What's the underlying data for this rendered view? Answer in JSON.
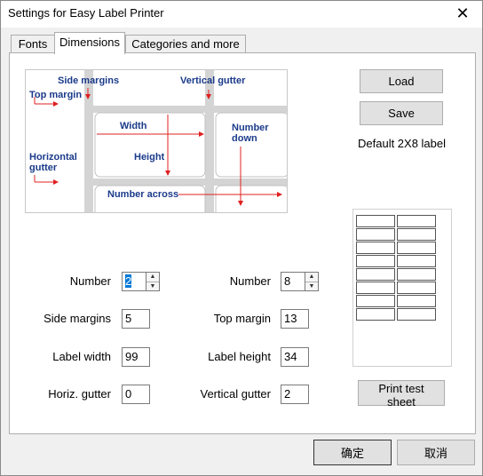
{
  "window": {
    "title": "Settings for Easy Label Printer",
    "close_glyph": "✕"
  },
  "tabs": [
    {
      "label": "Fonts",
      "active": false
    },
    {
      "label": "Dimensions",
      "active": true
    },
    {
      "label": "Categories and more",
      "active": false
    }
  ],
  "diagram": {
    "side_margins": "Side margins",
    "vertical_gutter": "Vertical gutter",
    "top_margin": "Top margin",
    "width": "Width",
    "number_down": "Number down",
    "horizontal_gutter": "Horizontal gutter",
    "height": "Height",
    "number_across": "Number across"
  },
  "buttons": {
    "load": "Load",
    "save": "Save",
    "print_test": "Print test sheet",
    "ok": "确定",
    "cancel": "取消"
  },
  "preset_text": "Default 2X8 label",
  "preview": {
    "columns": 2,
    "rows": 8
  },
  "fields": {
    "number_across": {
      "label": "Number",
      "value": "2"
    },
    "number_down": {
      "label": "Number",
      "value": "8"
    },
    "side_margins": {
      "label": "Side margins",
      "value": "5"
    },
    "top_margin": {
      "label": "Top margin",
      "value": "13"
    },
    "label_width": {
      "label": "Label width",
      "value": "99"
    },
    "label_height": {
      "label": "Label height",
      "value": "34"
    },
    "horiz_gutter": {
      "label": "Horiz. gutter",
      "value": "0"
    },
    "vertical_gutter": {
      "label": "Vertical gutter",
      "value": "2"
    }
  },
  "colors": {
    "accent": "#0078d7",
    "arrow": "#e02020",
    "diagram_text": "#1a3a8a",
    "frame": "#c8c8c8"
  }
}
